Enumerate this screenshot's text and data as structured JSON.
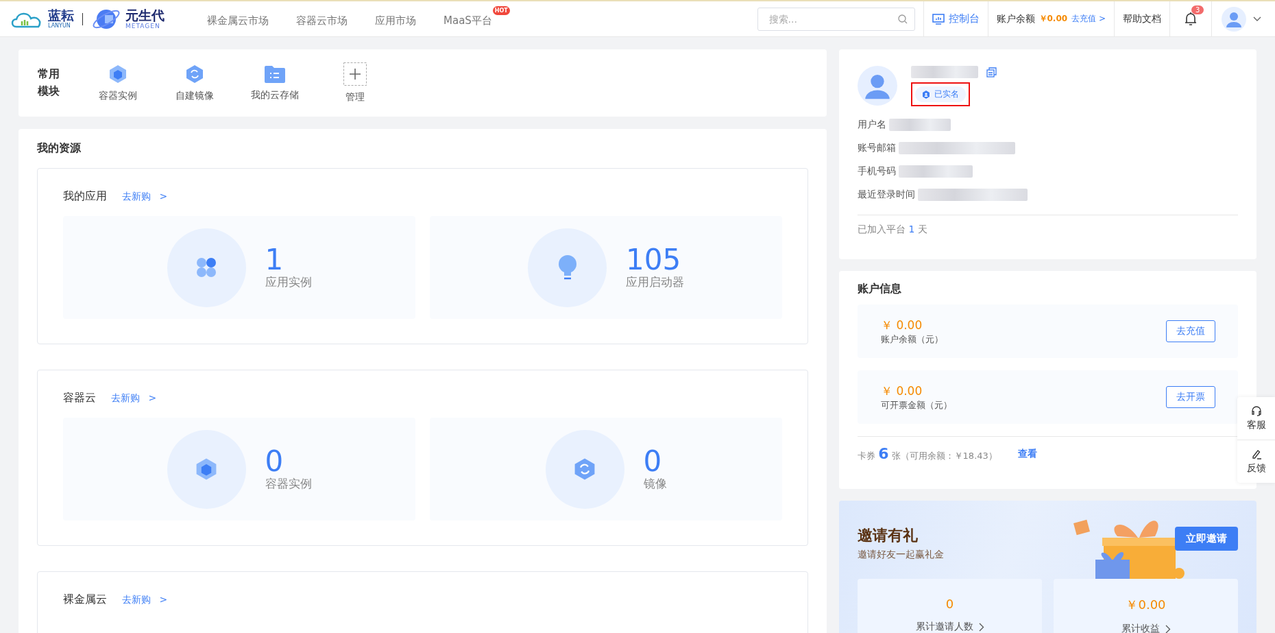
{
  "header": {
    "logo": {
      "brand": "蓝耘",
      "brand_sub": "LANYUN",
      "partner": "元生代",
      "partner_sub": "METAGEN"
    },
    "nav": [
      {
        "label": "裸金属云市场"
      },
      {
        "label": "容器云市场"
      },
      {
        "label": "应用市场"
      },
      {
        "label": "MaaS平台",
        "badge": "HOT"
      }
    ],
    "search": {
      "placeholder": "搜索..."
    },
    "console": "控制台",
    "balance": {
      "label": "账户余额",
      "amount": "￥0.00",
      "link": "去充值 >"
    },
    "help": "帮助文档",
    "notifications": {
      "count": "3"
    }
  },
  "modules": {
    "title": "常用模块",
    "items": [
      {
        "label": "容器实例",
        "kind": "cube"
      },
      {
        "label": "自建镜像",
        "kind": "mirror"
      },
      {
        "label": "我的云存储",
        "kind": "folder"
      },
      {
        "label": "管理",
        "kind": "plus"
      }
    ]
  },
  "resources": {
    "title": "我的资源",
    "groups": [
      {
        "title": "我的应用",
        "link": "去新购 >",
        "stats": [
          {
            "kind": "clover",
            "value": "1",
            "label": "应用实例"
          },
          {
            "kind": "bulb",
            "value": "105",
            "label": "应用启动器"
          }
        ]
      },
      {
        "title": "容器云",
        "link": "去新购 >",
        "stats": [
          {
            "kind": "cube",
            "value": "0",
            "label": "容器实例"
          },
          {
            "kind": "mirror",
            "value": "0",
            "label": "镜像"
          }
        ]
      },
      {
        "title": "裸金属云",
        "link": "去新购 >"
      }
    ]
  },
  "profile": {
    "verified": {
      "label": "已实名",
      "highlighted": true
    },
    "fields": [
      {
        "label": "用户名"
      },
      {
        "label": "账号邮箱"
      },
      {
        "label": "手机号码"
      },
      {
        "label": "最近登录时间"
      }
    ],
    "joined": {
      "prefix": "已加入平台",
      "value": "1",
      "suffix": "天"
    }
  },
  "account": {
    "title": "账户信息",
    "rows": [
      {
        "amount": "￥ 0.00",
        "label": "账户余额（元）",
        "button": "去充值"
      },
      {
        "amount": "￥ 0.00",
        "label": "可开票金额（元）",
        "button": "去开票"
      }
    ],
    "coupons": {
      "prefix": "卡券",
      "count": "6",
      "suffix": "张（可用余额：￥18.43）",
      "link": "查看"
    }
  },
  "invite": {
    "title": "邀请有礼",
    "subtitle": "邀请好友一起赢礼金",
    "button": "立即邀请",
    "stats": [
      {
        "value": "0",
        "label": "累计邀请人数"
      },
      {
        "value": "￥0.00",
        "label": "累计收益"
      }
    ]
  },
  "side": [
    {
      "kind": "headset",
      "label": "客服"
    },
    {
      "kind": "pen",
      "label": "反馈"
    }
  ]
}
